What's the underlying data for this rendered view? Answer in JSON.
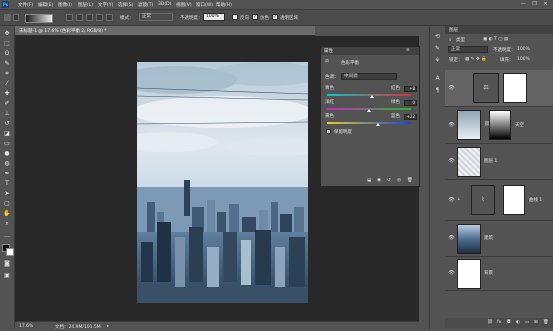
{
  "app": {
    "logo": "Ps"
  },
  "menu": [
    "文件(F)",
    "编辑(E)",
    "图像(I)",
    "图层(L)",
    "文字(Y)",
    "选择(S)",
    "滤镜(T)",
    "3D(D)",
    "视图(V)",
    "窗口(W)",
    "帮助(H)"
  ],
  "window_controls": {
    "minimize": "—",
    "restore": "❐",
    "close": "✕"
  },
  "options_bar": {
    "mode_label": "模式：",
    "mode_value": "正常",
    "opacity_label": "不透明度：",
    "opacity_value": "100%",
    "reverse_label": "反向",
    "dither_label": "仿色",
    "transparency_label": "透明区域"
  },
  "document": {
    "tab_title": "未标题-1 @ 17.6% (色彩平衡 2, RGB/8) *",
    "zoom": "17.6%",
    "doc_info": "文档：24.9M/101.5M"
  },
  "properties": {
    "tab": "属性",
    "panel_title": "色彩平衡",
    "tone_label": "色调：",
    "tone_value": "中间调",
    "sliders": [
      {
        "left": "青色",
        "right": "红色",
        "value": "+8",
        "fraction": 0.54
      },
      {
        "left": "洋红",
        "right": "绿色",
        "value": "0",
        "fraction": 0.5
      },
      {
        "left": "黄色",
        "right": "蓝色",
        "value": "+22",
        "fraction": 0.61
      }
    ],
    "preserve_label": "保留明度"
  },
  "layers": {
    "tab": "图层",
    "kind_label": "类型",
    "blend_value": "正常",
    "opacity_label": "不透明度：",
    "opacity_value": "100%",
    "lock_label": "锁定：",
    "fill_label": "填充：",
    "fill_value": "100%",
    "rows": [
      {
        "name": ""
      },
      {
        "name": "天空"
      },
      {
        "name": "图层 1"
      },
      {
        "name": "曲线 1"
      },
      {
        "name": "建筑"
      },
      {
        "name": "背景"
      }
    ]
  },
  "colors": {
    "ui_bg": "#535353",
    "workspace": "#282828",
    "panel_header": "#414141",
    "checkbox": "#e7e7e7"
  },
  "icons": {
    "tools": [
      "move-tool",
      "marquee-tool",
      "lasso-tool",
      "quick-select-tool",
      "crop-tool",
      "eyedropper-tool",
      "healing-tool",
      "brush-tool",
      "stamp-tool",
      "history-brush-tool",
      "eraser-tool",
      "gradient-tool",
      "blur-tool",
      "dodge-tool",
      "pen-tool",
      "type-tool",
      "path-select-tool",
      "shape-tool",
      "hand-tool",
      "zoom-tool"
    ]
  }
}
